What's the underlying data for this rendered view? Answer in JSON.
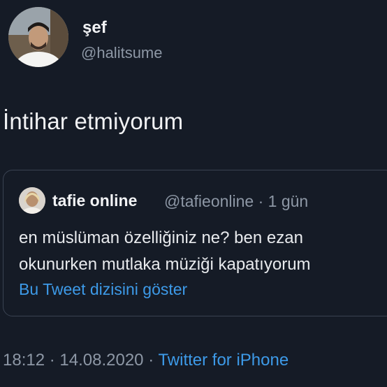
{
  "author": {
    "display_name": "şef",
    "handle": "@halitsume"
  },
  "tweet": {
    "text": "İntihar etmiyorum"
  },
  "quoted_tweet": {
    "display_name": "tafie online",
    "handle": "@tafieonline",
    "separator": "·",
    "age": "1 gün",
    "text": "en müslüman özelliğiniz ne? ben ezan okunurken mutlaka müziği kapatıyorum",
    "thread_link": "Bu Tweet dizisini göster"
  },
  "footer": {
    "time": "18:12",
    "sep1": "·",
    "date": "14.08.2020",
    "sep2": "·",
    "source": "Twitter for iPhone"
  },
  "colors": {
    "background": "#151b26",
    "link": "#3d9ae8",
    "muted": "#8d97a5"
  }
}
